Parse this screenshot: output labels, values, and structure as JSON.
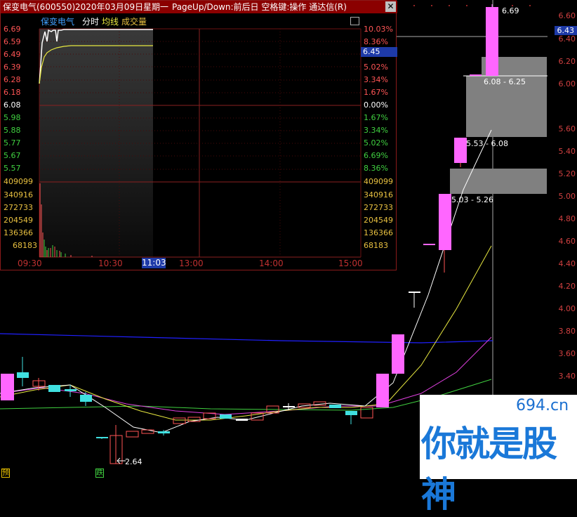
{
  "window": {
    "title_stock": "保变电气(600550)",
    "title_date": "2020年03月09日",
    "title_weekday": "星期一",
    "title_hint": "PageUp/Down:前后日 空格键:操作 通达信(R)",
    "close_label": "✕"
  },
  "intraday": {
    "tabs": [
      "保变电气",
      "分时",
      "均线",
      "成交量"
    ],
    "left_prices": [
      "6.69",
      "6.59",
      "6.49",
      "6.39",
      "6.28",
      "6.18",
      "6.08",
      "5.98",
      "5.88",
      "5.77",
      "5.67",
      "5.57"
    ],
    "right_pcts": [
      "10.03%",
      "8.36%",
      "6.45",
      "5.02%",
      "3.34%",
      "1.67%",
      "0.00%",
      "1.67%",
      "3.34%",
      "5.02%",
      "6.69%",
      "8.36%"
    ],
    "volume_labels": [
      "409099",
      "340916",
      "272733",
      "204549",
      "136366",
      "68183"
    ],
    "time_labels": [
      "09:30",
      "10:30",
      "11:03",
      "13:00",
      "14:00",
      "15:00"
    ],
    "current_price": "6.45"
  },
  "kline": {
    "right_axis": [
      "6.60",
      "6.40",
      "6.20",
      "6.00",
      "5.80",
      "5.60",
      "5.40",
      "5.20",
      "5.00",
      "4.80",
      "4.60",
      "4.40",
      "4.20",
      "4.00",
      "3.80",
      "3.60",
      "3.40"
    ],
    "current_price_tag": "6.43",
    "high_label": "6.69",
    "low_label": "2.64",
    "gap_labels": [
      "6.08 - 6.25",
      "5.53 - 6.08",
      "5.03 - 5.26"
    ],
    "bottom_markers": [
      "预",
      "跌"
    ]
  },
  "watermark": {
    "domain": "694.cn",
    "slogan": "你就是股神"
  },
  "colors": {
    "up": "#ff5555",
    "down": "#40e0e0",
    "limit_up": "#ff66ff",
    "title_bar": "#8b0000",
    "highlight": "#1e3aa8"
  }
}
